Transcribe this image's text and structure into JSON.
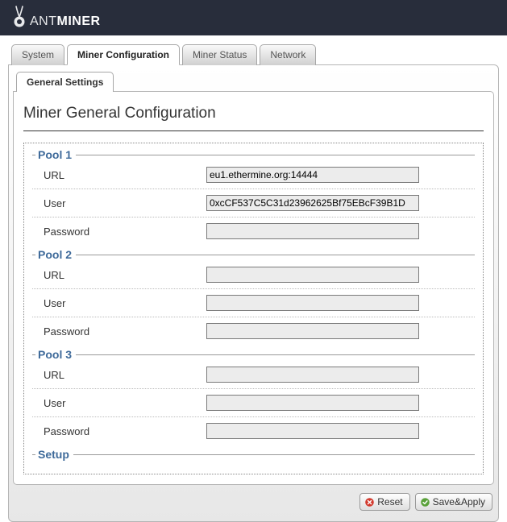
{
  "brand": {
    "part1": "ANT",
    "part2": "MINER"
  },
  "mainTabs": [
    {
      "label": "System",
      "active": false
    },
    {
      "label": "Miner Configuration",
      "active": true
    },
    {
      "label": "Miner Status",
      "active": false
    },
    {
      "label": "Network",
      "active": false
    }
  ],
  "subTabs": [
    {
      "label": "General Settings",
      "active": true
    }
  ],
  "pageTitle": "Miner General Configuration",
  "pools": [
    {
      "legend": "Pool 1",
      "url": "eu1.ethermine.org:14444",
      "user": "0xcCF537C5C31d23962625Bf75EBcF39B1D",
      "password": ""
    },
    {
      "legend": "Pool 2",
      "url": "",
      "user": "",
      "password": ""
    },
    {
      "legend": "Pool 3",
      "url": "",
      "user": "",
      "password": ""
    }
  ],
  "setupLegend": "Setup",
  "fieldLabels": {
    "url": "URL",
    "user": "User",
    "password": "Password"
  },
  "buttons": {
    "reset": "Reset",
    "saveApply": "Save&Apply"
  }
}
